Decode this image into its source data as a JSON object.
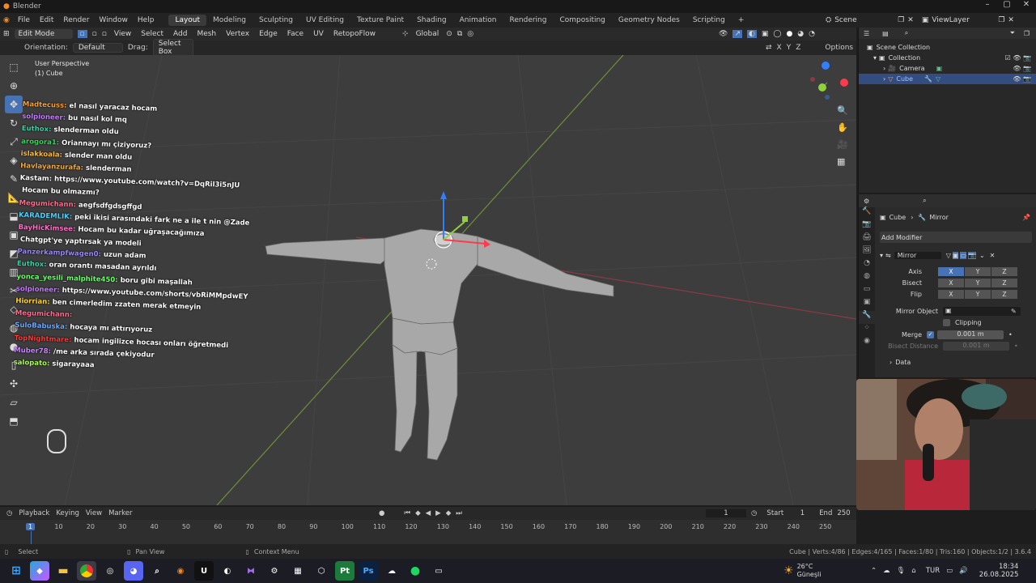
{
  "window": {
    "title": "Blender"
  },
  "menu": [
    "File",
    "Edit",
    "Render",
    "Window",
    "Help"
  ],
  "workspaces": [
    "Layout",
    "Modeling",
    "Sculpting",
    "UV Editing",
    "Texture Paint",
    "Shading",
    "Animation",
    "Rendering",
    "Compositing",
    "Geometry Nodes",
    "Scripting"
  ],
  "active_workspace": "Layout",
  "scene": {
    "label": "Scene",
    "view_layer": "ViewLayer"
  },
  "viewport_header": {
    "mode": "Edit Mode",
    "menus": [
      "View",
      "Select",
      "Add",
      "Mesh",
      "Vertex",
      "Edge",
      "Face",
      "UV",
      "RetopoFlow"
    ],
    "transform": "Global"
  },
  "tool_header": {
    "orientation_label": "Orientation:",
    "orientation_value": "Default",
    "drag_label": "Drag:",
    "drag_value": "Select Box",
    "options": "Options",
    "axes": [
      "X",
      "Y",
      "Z"
    ]
  },
  "viewport_info": {
    "line1": "User Perspective",
    "line2": "(1) Cube"
  },
  "chat": [
    {
      "user": "Madtecuss:",
      "text": "el nasıl yaracaz hocam",
      "color": "#ff9f2e"
    },
    {
      "user": "solpioneer:",
      "text": "bu nasıl kol mq",
      "color": "#c47bff"
    },
    {
      "user": "Euthox:",
      "text": "slenderman oldu",
      "color": "#3cd2a6"
    },
    {
      "user": "arogora1:",
      "text": "Oriannayı mı çiziyoruz?",
      "color": "#37d657"
    },
    {
      "user": "islakkoala:",
      "text": "slender man oldu",
      "color": "#ffbb3a"
    },
    {
      "user": "Havlayanzurafa:",
      "text": "slenderman",
      "color": "#f4a93a"
    },
    {
      "user": "Kastam:",
      "text": "https://www.youtube.com/watch?v=DqRil3i5nJU",
      "color": "#ffffff"
    },
    {
      "user": "",
      "text": "Hocam bu olmazmı?",
      "color": "#ffffff"
    },
    {
      "user": "Megumichann:",
      "text": "aegfsdfgdsgffgd",
      "color": "#ff6e8f"
    },
    {
      "user": "KARADEMLIK:",
      "text": "peki ikisi arasındaki fark ne a ile t nin @Zade",
      "color": "#4bd0ff"
    },
    {
      "user": "BayHicKimsee:",
      "text": "Hocam bu kadar uğraşacağımıza",
      "color": "#ff6ec7"
    },
    {
      "user": "",
      "text": "Chatgpt'ye yaptırsak ya modeli",
      "color": "#ffffff"
    },
    {
      "user": "Panzerkampfwagen0:",
      "text": "uzun adam",
      "color": "#9a86ff"
    },
    {
      "user": "Euthox:",
      "text": "oran orantı masadan ayrıldı",
      "color": "#3cd2a6"
    },
    {
      "user": "yonca_yesili_malphite450:",
      "text": "boru gibi maşallah",
      "color": "#6cff6c"
    },
    {
      "user": "solpioneer:",
      "text": "https://www.youtube.com/shorts/vbRiMMpdwEY",
      "color": "#c47bff"
    },
    {
      "user": "Hiorrian:",
      "text": "ben cimerledim zzaten merak etmeyin",
      "color": "#ffd23a"
    },
    {
      "user": "Megumichann:",
      "text": "",
      "color": "#ff6e8f"
    },
    {
      "user": "SuloBabuska:",
      "text": "hocaya mı attırıyoruz",
      "color": "#6ea8ff"
    },
    {
      "user": "TopNightmare:",
      "text": "hocam ingilizce hocası onları öğretmedi",
      "color": "#ff3a3a"
    },
    {
      "user": "Muber78:",
      "text": "/me arka sırada çekiyodur",
      "color": "#c986ff"
    },
    {
      "user": "salopato:",
      "text": "sigarayaaa",
      "color": "#a6ff4a"
    }
  ],
  "outliner": {
    "root": "Scene Collection",
    "items": [
      {
        "label": "Collection"
      },
      {
        "label": "Camera"
      },
      {
        "label": "Cube",
        "selected": true
      }
    ]
  },
  "properties": {
    "breadcrumb_object": "Cube",
    "breadcrumb_modifier": "Mirror",
    "add_modifier": "Add Modifier",
    "modifier_name": "Mirror",
    "rows": [
      {
        "label": "Axis",
        "values": [
          "X",
          "Y",
          "Z"
        ],
        "active": [
          true,
          false,
          false
        ]
      },
      {
        "label": "Bisect",
        "values": [
          "X",
          "Y",
          "Z"
        ],
        "active": [
          false,
          false,
          false
        ]
      },
      {
        "label": "Flip",
        "values": [
          "X",
          "Y",
          "Z"
        ],
        "active": [
          false,
          false,
          false
        ]
      }
    ],
    "mirror_object": "Mirror Object",
    "clipping": "Clipping",
    "merge_label": "Merge",
    "merge_value": "0.001 m",
    "bisect_distance_label": "Bisect Distance",
    "bisect_distance_value": "0.001 m",
    "data": "Data"
  },
  "timeline": {
    "menus": [
      "Playback",
      "Keying",
      "View",
      "Marker"
    ],
    "current_frame": "1",
    "start_label": "Start",
    "start_value": "1",
    "end_label": "End",
    "end_value": "250",
    "ticks": [
      "1",
      "10",
      "20",
      "30",
      "40",
      "50",
      "60",
      "70",
      "80",
      "90",
      "100",
      "110",
      "120",
      "130",
      "140",
      "150",
      "160",
      "170",
      "180",
      "190",
      "200",
      "210",
      "220",
      "230",
      "240",
      "250"
    ]
  },
  "statusbar": {
    "select": "Select",
    "pan": "Pan View",
    "context": "Context Menu",
    "stats": "Cube | Verts:4/86 | Edges:4/165 | Faces:1/80 | Tris:160 | Objects:1/2 | 3.6.4"
  },
  "taskbar": {
    "weather_temp": "26°C",
    "weather_desc": "Güneşli",
    "lang": "TUR",
    "time": "18:34",
    "date": "26.08.2025"
  }
}
